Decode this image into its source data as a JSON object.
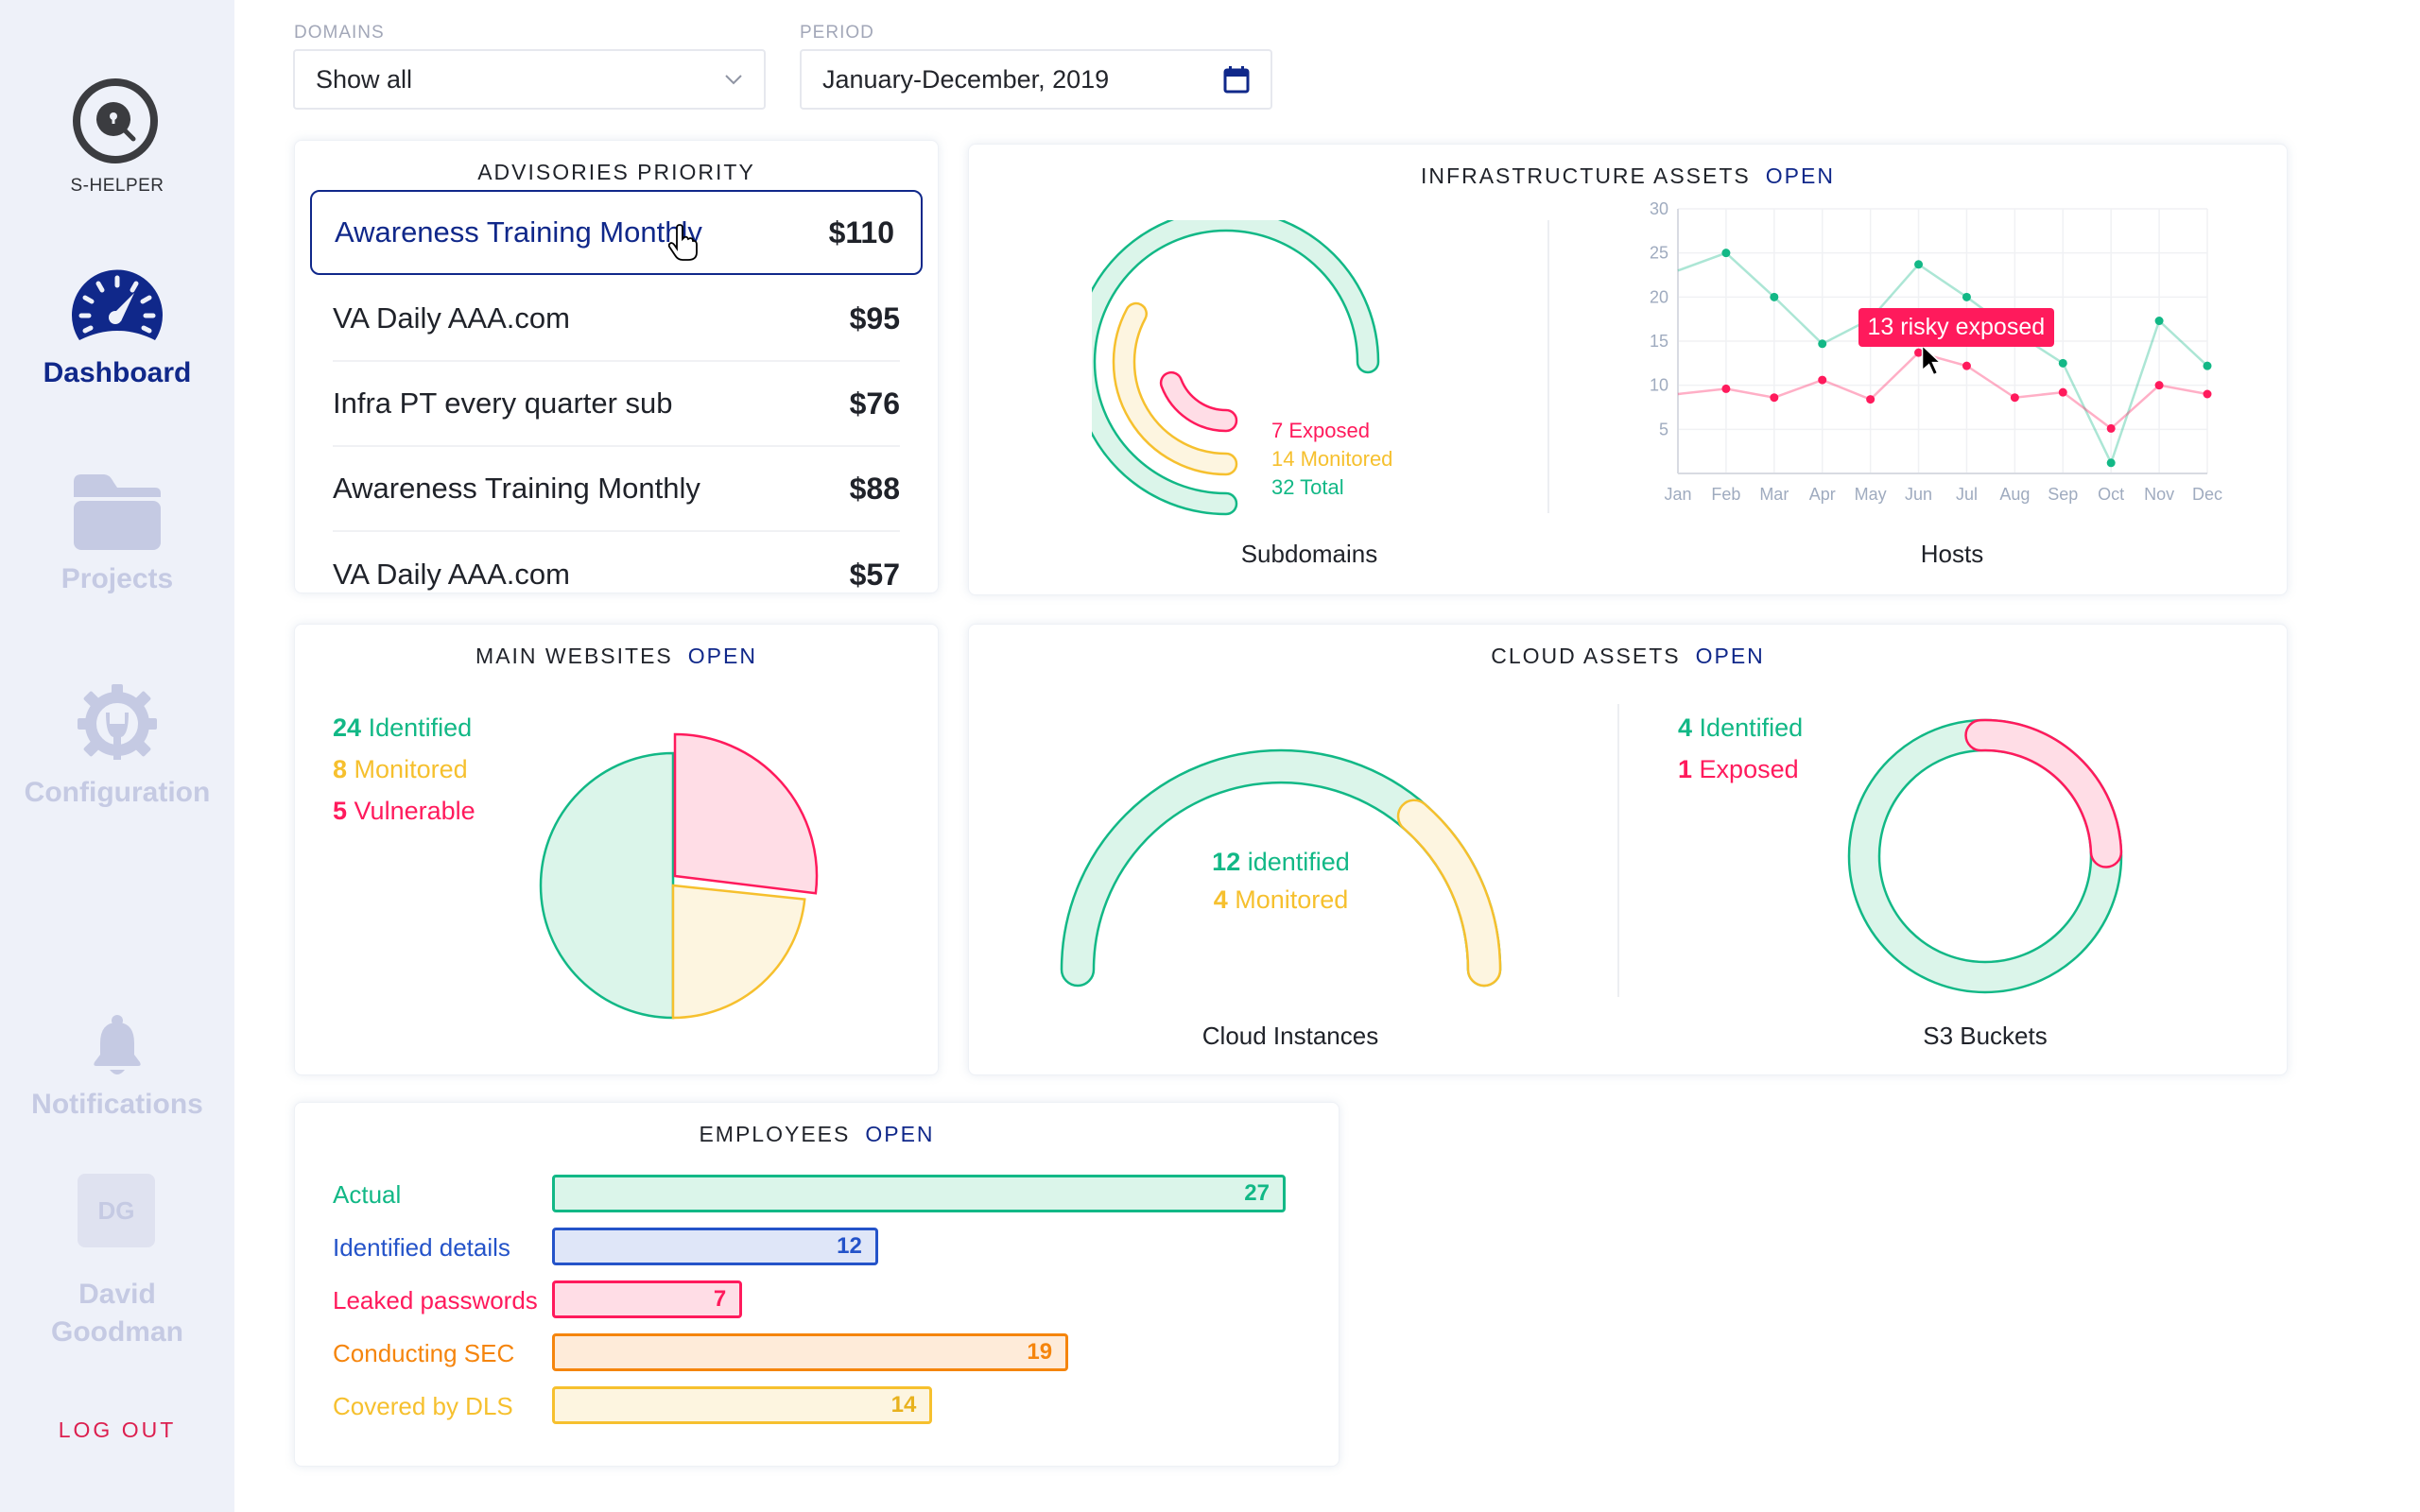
{
  "app": {
    "name": "S-HELPER"
  },
  "sidebar": {
    "items": [
      {
        "label": "Dashboard",
        "icon": "dashboard-gauge-icon",
        "active": true
      },
      {
        "label": "Projects",
        "icon": "folder-icon",
        "active": false
      },
      {
        "label": "Configuration",
        "icon": "gear-wrench-icon",
        "active": false
      },
      {
        "label": "Notifications",
        "icon": "bell-icon",
        "active": false
      }
    ],
    "user": {
      "initials": "DG",
      "name_line1": "David",
      "name_line2": "Goodman"
    },
    "logout_label": "LOG OUT"
  },
  "filters": {
    "domains": {
      "label": "DOMAINS",
      "value": "Show all"
    },
    "period": {
      "label": "PERIOD",
      "value": "January-December, 2019"
    }
  },
  "advisories": {
    "title": "ADVISORIES PRIORITY",
    "items": [
      {
        "name": "Awareness Training Monthly",
        "price": "$110",
        "selected": true
      },
      {
        "name": "VA Daily AAA.com",
        "price": "$95"
      },
      {
        "name": "Infra PT every quarter sub",
        "price": "$76"
      },
      {
        "name": "Awareness Training Monthly",
        "price": "$88"
      },
      {
        "name": "VA Daily AAA.com",
        "price": "$57"
      }
    ]
  },
  "infrastructure": {
    "title": "INFRASTRUCTURE ASSETS",
    "open_label": "OPEN",
    "subdomains_label": "Subdomains",
    "hosts_label": "Hosts",
    "tooltip": "13 risky exposed"
  },
  "main_websites": {
    "title": "MAIN WEBSITES",
    "open_label": "OPEN"
  },
  "cloud_assets": {
    "title": "CLOUD ASSETS",
    "open_label": "OPEN",
    "instances_label": "Cloud Instances",
    "s3_label": "S3 Buckets"
  },
  "employees": {
    "title": "EMPLOYEES",
    "open_label": "OPEN"
  },
  "colors": {
    "green": "#12b886",
    "green_fill": "#dbf5ea",
    "yellow": "#f6c02e",
    "yellow_fill": "#fdf5e0",
    "pink": "#ff1a5c",
    "pink_fill": "#ffdde6",
    "blue": "#2453c9",
    "blue_fill": "#dfe6f8",
    "orange": "#f5850d",
    "orange_fill": "#feebd9",
    "navy": "#10288a"
  },
  "chart_data": [
    {
      "id": "subdomains",
      "type": "radial-bar",
      "title": "Subdomains",
      "series": [
        {
          "name": "Exposed",
          "value": 7,
          "color": "pink"
        },
        {
          "name": "Monitored",
          "value": 14,
          "color": "yellow"
        },
        {
          "name": "Total",
          "value": 32,
          "color": "green"
        }
      ]
    },
    {
      "id": "hosts",
      "type": "line",
      "title": "Hosts",
      "categories": [
        "Jan",
        "Feb",
        "Mar",
        "Apr",
        "May",
        "Jun",
        "Jul",
        "Aug",
        "Sep",
        "Oct",
        "Nov",
        "Dec"
      ],
      "yticks": [
        5,
        10,
        15,
        20,
        25,
        30
      ],
      "ylim": [
        0,
        30
      ],
      "grid": true,
      "series": [
        {
          "name": "Total hosts",
          "color": "green",
          "values": [
            23,
            25,
            20,
            14.7,
            17.5,
            23.7,
            20,
            16,
            12.5,
            1.2,
            17.3,
            12.2
          ]
        },
        {
          "name": "Risky exposed",
          "color": "pink",
          "values": [
            9,
            9.6,
            8.6,
            10.6,
            8.4,
            13.7,
            12.2,
            8.6,
            9.2,
            5.1,
            10,
            9
          ]
        }
      ],
      "annotation": {
        "category": "Jun",
        "series": "Risky exposed",
        "text": "13 risky exposed"
      }
    },
    {
      "id": "websites",
      "type": "pie",
      "title": "MAIN WEBSITES",
      "slices": [
        {
          "name": "Identified",
          "value": 24,
          "color": "green"
        },
        {
          "name": "Monitored",
          "value": 8,
          "color": "yellow"
        },
        {
          "name": "Vulnerable",
          "value": 5,
          "color": "pink"
        }
      ]
    },
    {
      "id": "cloud-instances",
      "type": "gauge",
      "title": "Cloud Instances",
      "series": [
        {
          "name": "identified",
          "value": 12,
          "color": "green"
        },
        {
          "name": "Monitored",
          "value": 4,
          "color": "yellow"
        }
      ]
    },
    {
      "id": "s3-buckets",
      "type": "donut",
      "title": "S3 Buckets",
      "series": [
        {
          "name": "Identified",
          "value": 4,
          "color": "green"
        },
        {
          "name": "Exposed",
          "value": 1,
          "color": "pink"
        }
      ]
    },
    {
      "id": "employees",
      "type": "bar",
      "title": "EMPLOYEES",
      "orientation": "horizontal",
      "categories": [
        "Actual",
        "Identified details",
        "Leaked passwords",
        "Conducting SEC",
        "Covered by DLS"
      ],
      "values": [
        27,
        12,
        7,
        19,
        14
      ],
      "colors": [
        "green",
        "blue",
        "pink",
        "orange",
        "yellow"
      ]
    }
  ]
}
